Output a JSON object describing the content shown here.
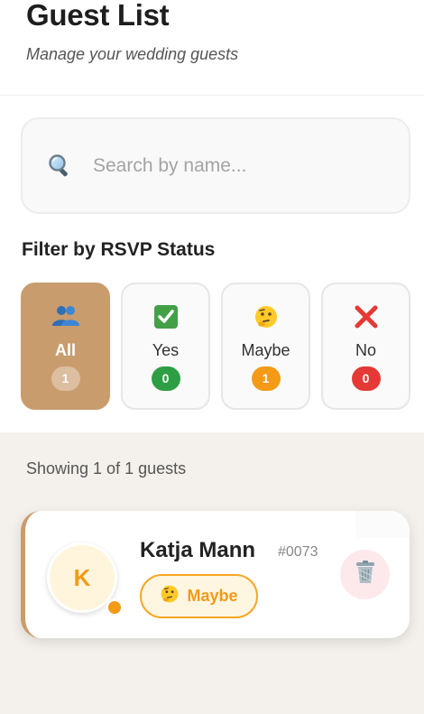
{
  "header": {
    "title": "Guest List",
    "subtitle": "Manage your wedding guests"
  },
  "search": {
    "placeholder": "Search by name...",
    "value": "",
    "icon": "search-icon"
  },
  "filter": {
    "label": "Filter by RSVP Status",
    "options": [
      {
        "id": "all",
        "label": "All",
        "count": "1",
        "icon": "people-icon",
        "active": true
      },
      {
        "id": "yes",
        "label": "Yes",
        "count": "0",
        "icon": "check-icon",
        "color": "#2e9e44"
      },
      {
        "id": "maybe",
        "label": "Maybe",
        "count": "1",
        "icon": "thinking-face-icon",
        "color": "#f39a16"
      },
      {
        "id": "no",
        "label": "No",
        "count": "0",
        "icon": "cross-icon",
        "color": "#e53935"
      }
    ]
  },
  "results": {
    "showing_text": "Showing 1 of 1 guests"
  },
  "guests": [
    {
      "initial": "K",
      "name": "Katja Mann",
      "id": "#0073",
      "rsvp": "Maybe",
      "status_color": "#f39a16"
    }
  ],
  "colors": {
    "accent": "#c99c6e",
    "maybe": "#f39a16",
    "yes": "#2e9e44",
    "no": "#e53935"
  }
}
